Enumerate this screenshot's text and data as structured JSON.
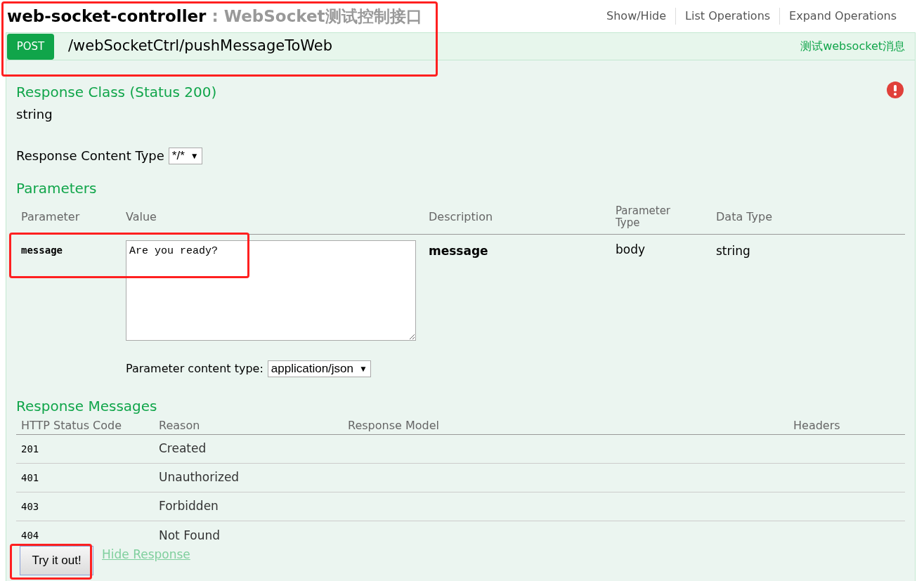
{
  "header": {
    "name": "web-socket-controller",
    "separator": ":",
    "description": "WebSocket测试控制接口",
    "links": [
      "Show/Hide",
      "List Operations",
      "Expand Operations"
    ]
  },
  "operation": {
    "method": "POST",
    "path": "/webSocketCtrl/pushMessageToWeb",
    "summary": "测试websocket消息"
  },
  "response_class": {
    "title": "Response Class (Status 200)",
    "type": "string"
  },
  "response_content_type": {
    "label": "Response Content Type",
    "value": "*/*",
    "caret": "▼"
  },
  "parameters": {
    "title": "Parameters",
    "columns": [
      "Parameter",
      "Value",
      "Description",
      "Parameter Type",
      "Data Type"
    ],
    "rows": [
      {
        "name": "message",
        "value": "Are you ready?",
        "description": "message",
        "param_type": "body",
        "data_type": "string"
      }
    ],
    "content_type": {
      "label": "Parameter content type:",
      "value": "application/json",
      "caret": "▼"
    }
  },
  "response_messages": {
    "title": "Response Messages",
    "columns": [
      "HTTP Status Code",
      "Reason",
      "Response Model",
      "Headers"
    ],
    "rows": [
      {
        "code": "201",
        "reason": "Created"
      },
      {
        "code": "401",
        "reason": "Unauthorized"
      },
      {
        "code": "403",
        "reason": "Forbidden"
      },
      {
        "code": "404",
        "reason": "Not Found"
      }
    ]
  },
  "actions": {
    "try_button": "Try it out!",
    "hide_link": "Hide Response"
  }
}
